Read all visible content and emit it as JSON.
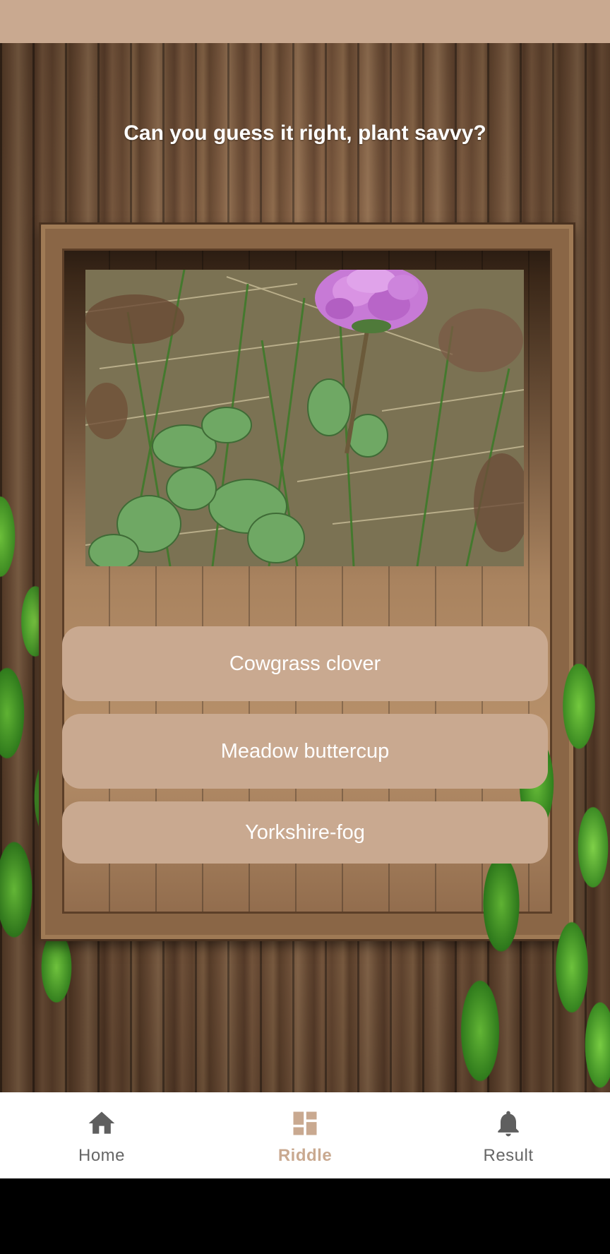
{
  "question": "Can you guess it right, plant savvy?",
  "image": {
    "subject": "clover-flower-photo"
  },
  "answers": [
    {
      "label": "Cowgrass clover"
    },
    {
      "label": "Meadow buttercup"
    },
    {
      "label": "Yorkshire-fog"
    }
  ],
  "nav": {
    "items": [
      {
        "label": "Home",
        "icon": "home-icon",
        "active": false
      },
      {
        "label": "Riddle",
        "icon": "grid-icon",
        "active": true
      },
      {
        "label": "Result",
        "icon": "bell-icon",
        "active": false
      }
    ]
  },
  "colors": {
    "accent": "#c9a990",
    "nav_inactive": "#666666",
    "button_text": "#ffffff"
  }
}
